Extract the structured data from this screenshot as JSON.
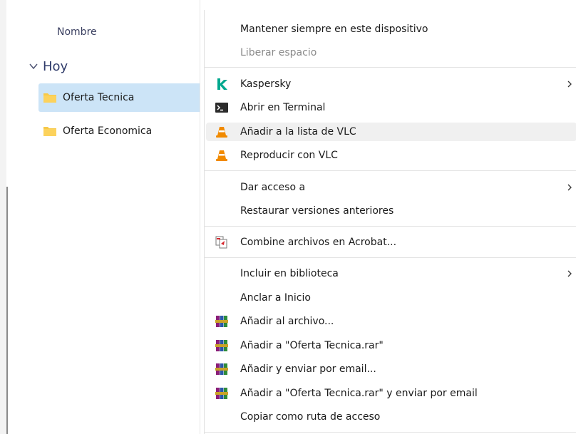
{
  "explorer": {
    "column_header": "Nombre",
    "group_label": "Hoy",
    "files": [
      {
        "name": "Oferta Tecnica",
        "selected": true
      },
      {
        "name": "Oferta Economica",
        "selected": false
      }
    ]
  },
  "context_menu": {
    "items": [
      {
        "label": "Mantener siempre en este dispositivo"
      },
      {
        "label": "Liberar espacio",
        "disabled": true
      },
      {
        "label": "Kaspersky",
        "icon": "kaspersky-icon",
        "submenu": true
      },
      {
        "label": "Abrir en Terminal",
        "icon": "terminal-icon"
      },
      {
        "label": "Añadir a la lista de VLC",
        "icon": "vlc-icon",
        "highlighted": true
      },
      {
        "label": "Reproducir con VLC",
        "icon": "vlc-icon"
      },
      {
        "label": "Dar acceso a",
        "submenu": true
      },
      {
        "label": "Restaurar versiones anteriores"
      },
      {
        "label": "Combine archivos en Acrobat...",
        "icon": "acrobat-combine-icon"
      },
      {
        "label": "Incluir en biblioteca",
        "submenu": true
      },
      {
        "label": "Anclar a Inicio"
      },
      {
        "label": "Añadir al archivo...",
        "icon": "winrar-icon"
      },
      {
        "label": "Añadir a \"Oferta Tecnica.rar\"",
        "icon": "winrar-icon"
      },
      {
        "label": "Añadir y enviar por email...",
        "icon": "winrar-icon"
      },
      {
        "label": "Añadir a \"Oferta Tecnica.rar\" y enviar por email",
        "icon": "winrar-icon"
      },
      {
        "label": "Copiar como ruta de acceso"
      }
    ]
  },
  "colors": {
    "selection": "#cce4f7",
    "folder": "#f7c948",
    "kaspersky": "#00a88e",
    "vlc": "#f18a00",
    "winrar": "#8b1e78"
  }
}
